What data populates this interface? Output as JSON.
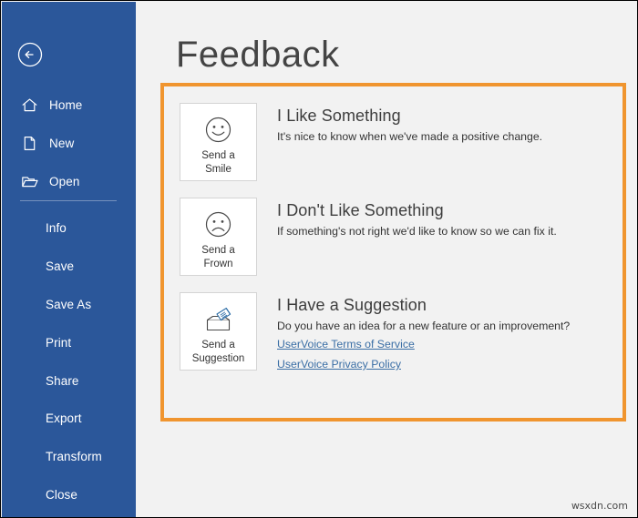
{
  "window": {
    "title": "Feedback"
  },
  "colors": {
    "sidebar_blue": "#2b579a",
    "highlight_orange": "#f0952f",
    "content_bg": "#f2f2f2",
    "link_blue": "#3a6ea5"
  },
  "sidebar": {
    "back_label": "Back",
    "back_icon": "arrow-left-circle-icon",
    "top_items": [
      {
        "label": "Home",
        "icon": "home-icon"
      },
      {
        "label": "New",
        "icon": "new-document-icon"
      },
      {
        "label": "Open",
        "icon": "open-folder-icon"
      }
    ],
    "bottom_items": [
      {
        "label": "Info"
      },
      {
        "label": "Save"
      },
      {
        "label": "Save As"
      },
      {
        "label": "Print"
      },
      {
        "label": "Share"
      },
      {
        "label": "Export"
      },
      {
        "label": "Transform"
      },
      {
        "label": "Close"
      }
    ]
  },
  "main": {
    "heading": "Feedback",
    "cards": [
      {
        "tile_label": "Send a\nSmile",
        "tile_label_line1": "Send a",
        "tile_label_line2": "Smile",
        "icon": "smiley-face-icon",
        "title": "I Like Something",
        "description": "It's nice to know when we've made a positive change.",
        "links": []
      },
      {
        "tile_label_line1": "Send a",
        "tile_label_line2": "Frown",
        "icon": "frowny-face-icon",
        "title": "I Don't Like Something",
        "description": "If something's not right we'd like to know so we can fix it.",
        "links": []
      },
      {
        "tile_label_line1": "Send a",
        "tile_label_line2": "Suggestion",
        "icon": "suggestion-box-icon",
        "title": "I Have a Suggestion",
        "description": "Do you have an idea for a new feature or an improvement?",
        "links": [
          {
            "label": "UserVoice Terms of Service"
          },
          {
            "label": "UserVoice Privacy Policy"
          }
        ]
      }
    ]
  },
  "watermark": {
    "text": "wsxdn.com"
  }
}
